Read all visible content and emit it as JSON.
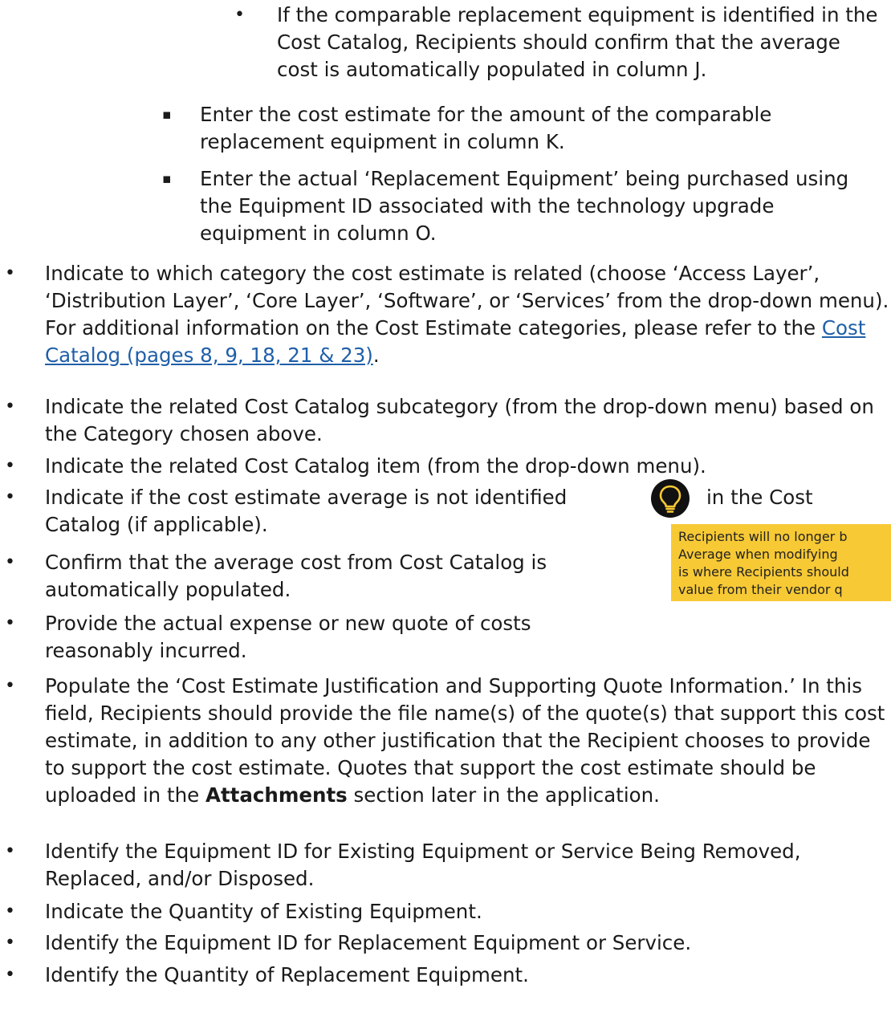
{
  "bullets": {
    "level3": "•",
    "level2": "▪",
    "level1": "•"
  },
  "items": {
    "i0": "If the comparable replacement equipment is identified in the Cost Catalog, Recipients should confirm that the average cost is automatically populated in column J.",
    "i1": "Enter the cost estimate for the amount of the comparable replacement equipment in column K.",
    "i2": "Enter the actual ‘Replacement Equipment’ being purchased using the Equipment ID associated with the technology upgrade equipment in column O.",
    "i3_text": "Indicate to which category the cost estimate is related (choose ‘Access Layer’, ‘Distribution Layer’, ‘Core Layer’, ‘Software’, or ‘Services’ from the drop-down menu). For additional information on the Cost Estimate categories, please refer to the ",
    "i3_link": "Cost Catalog (pages 8, 9, 18, 21 & 23)",
    "i3_end": ".",
    "i4": "Indicate the related Cost Catalog subcategory (from the drop-down menu) based on the Category chosen above.",
    "i5": "Indicate the related Cost Catalog item (from the drop-down menu).",
    "i6_head": "Indicate if the cost estimate average is not identified",
    "i6_tail": "in the Cost",
    "i6_next": "Catalog (if applicable).",
    "i7": "Confirm that the average cost from Cost Catalog is automatically populated.",
    "i8": "Provide the actual expense or new quote of costs reasonably incurred.",
    "i9_text": "Populate the ‘Cost Estimate Justification and Supporting Quote Information.’ In this field, Recipients should provide the file name(s) of the quote(s) that support this cost estimate, in addition to any other justification that the Recipient chooses to provide to support the cost estimate. Quotes that support the cost estimate should be uploaded in the ",
    "i9_bold": "Attachments",
    "i9_end": " section later in the application.",
    "i10": "Identify the Equipment ID for Existing Equipment or Service Being Removed, Replaced, and/or Disposed.",
    "i11": "Indicate the Quantity of Existing Equipment.",
    "i12": "Identify the Equipment ID for Replacement Equipment or Service.",
    "i13": "Identify the Quantity of Replacement Equipment."
  },
  "tooltip": {
    "icon": "lightbulb-icon",
    "bg_color": "#f7c934",
    "lines": [
      "Recipients will no longer b",
      "Average when modifying",
      "is where Recipients should",
      "value from their vendor q"
    ]
  }
}
